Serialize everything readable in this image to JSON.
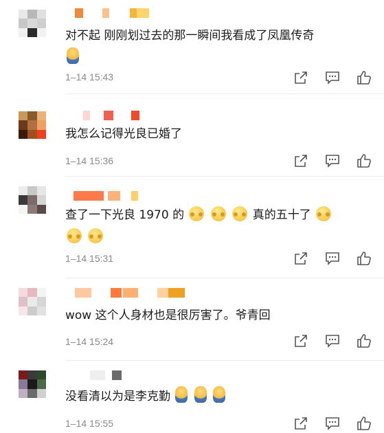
{
  "comments": [
    {
      "text": "对不起 刚刚划过去的那一瞬间我看成了凤凰传奇",
      "timestamp": "1–14 15:43",
      "avatar_colors": [
        "#e9e9e9",
        "#b8b8b8",
        "#e0e0e0",
        "#c7c7c7",
        "#d9d9d9",
        "#cfcfcf",
        "#f0f0f0",
        "#2b2b2b",
        "#f2f2f2"
      ],
      "name_colors": [
        "#f08a3a",
        "#ffc18c",
        "#f6b63b",
        "#ffd56b"
      ],
      "emojis": [
        "figure"
      ]
    },
    {
      "text": "我怎么记得光良已婚了",
      "timestamp": "1–14 15:36",
      "avatar_colors": [
        "#c89a5a",
        "#8a5a2a",
        "#e8b47a",
        "#6a3a1a",
        "#b07040",
        "#f0a060",
        "#3a1a0a",
        "#a05020",
        "#f04020"
      ],
      "name_colors": [
        "#ffd7d0",
        "#f06050",
        "#f04a2a"
      ],
      "emojis": []
    },
    {
      "text": "查了一下光良 1970 的",
      "text2": "真的五十了",
      "timestamp": "1–14 15:31",
      "avatar_colors": [
        "#ececec",
        "#c8c8c8",
        "#e6e6e6",
        "#3a3a3a",
        "#7a6a6a",
        "#d6d6d6",
        "#f4f4f4",
        "#8a7a7a",
        "#5a4a4a"
      ],
      "name_colors": [
        "#ff7a4a",
        "#ffb27a",
        "#ffd06a"
      ],
      "emojis": [
        "smile",
        "smile",
        "smile",
        "smile",
        "smile",
        "smile"
      ]
    },
    {
      "text": "wow 这个人身材也是很厉害了。爷青回",
      "timestamp": "1–14 15:24",
      "avatar_colors": [
        "#f2dadd",
        "#e7b8c0",
        "#f4f4f4",
        "#e0c0c8",
        "#eaeaea",
        "#d6d6d6",
        "#f6e6e8",
        "#cccccc",
        "#e2e2e2"
      ],
      "name_colors": [
        "#ffc8a0",
        "#ff7a3a",
        "#ffb070",
        "#ffd0a0",
        "#f0a020"
      ],
      "emojis": []
    },
    {
      "text": "没看清以为是李克勤",
      "timestamp": "1–14 15:55",
      "avatar_colors": [
        "#7a1a1a",
        "#3a3a3a",
        "#2a4a2a",
        "#8a7a9a",
        "#1a1a1a",
        "#4a6a4a",
        "#c0b0c0",
        "#6a6a6a",
        "#d0d0d0"
      ],
      "name_colors": [
        "#eeeeee",
        "#6a6a6a"
      ],
      "emojis": [
        "figure",
        "figure",
        "figure"
      ]
    }
  ],
  "actions": {
    "share_icon": "share-icon",
    "comment_icon": "comment-icon",
    "like_icon": "like-icon"
  }
}
